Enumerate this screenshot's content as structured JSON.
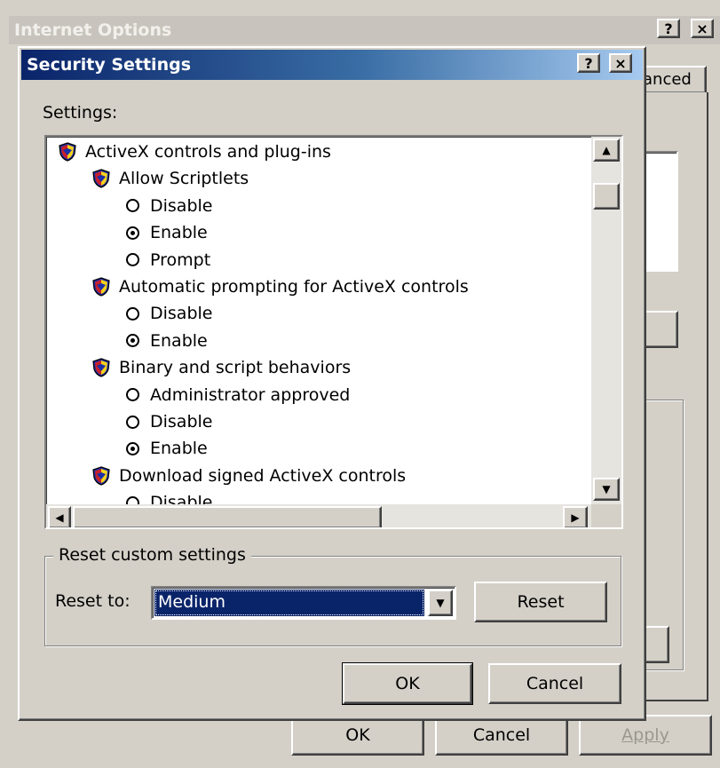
{
  "outer_window": {
    "title": "Internet Options",
    "help_btn": "?",
    "close_btn": "×",
    "tab_label": "anced",
    "buttons": {
      "ok": "OK",
      "cancel": "Cancel",
      "apply": "Apply"
    }
  },
  "dialog": {
    "title": "Security Settings",
    "help_btn": "?",
    "close_btn": "×",
    "settings_label": "Settings:",
    "tree": [
      {
        "level": 0,
        "kind": "group",
        "label": "ActiveX controls and plug-ins"
      },
      {
        "level": 1,
        "kind": "setting",
        "label": "Allow Scriptlets"
      },
      {
        "level": 2,
        "kind": "radio",
        "label": "Disable",
        "checked": false
      },
      {
        "level": 2,
        "kind": "radio",
        "label": "Enable",
        "checked": true
      },
      {
        "level": 2,
        "kind": "radio",
        "label": "Prompt",
        "checked": false
      },
      {
        "level": 1,
        "kind": "setting",
        "label": "Automatic prompting for ActiveX controls"
      },
      {
        "level": 2,
        "kind": "radio",
        "label": "Disable",
        "checked": false
      },
      {
        "level": 2,
        "kind": "radio",
        "label": "Enable",
        "checked": true
      },
      {
        "level": 1,
        "kind": "setting",
        "label": "Binary and script behaviors"
      },
      {
        "level": 2,
        "kind": "radio",
        "label": "Administrator approved",
        "checked": false
      },
      {
        "level": 2,
        "kind": "radio",
        "label": "Disable",
        "checked": false
      },
      {
        "level": 2,
        "kind": "radio",
        "label": "Enable",
        "checked": true
      },
      {
        "level": 1,
        "kind": "setting",
        "label": "Download signed ActiveX controls"
      },
      {
        "level": 2,
        "kind": "radio",
        "label": "Disable",
        "checked": false
      }
    ],
    "reset_group": {
      "legend": "Reset custom settings",
      "reset_to_label": "Reset to:",
      "selected_value": "Medium",
      "reset_button": "Reset"
    },
    "buttons": {
      "ok": "OK",
      "cancel": "Cancel"
    }
  },
  "icons": {
    "shield_colors": {
      "blue": "#1c2fa8",
      "yellow": "#f6d21a",
      "red": "#c8202a"
    },
    "titlebar_active": "#0a246a"
  }
}
